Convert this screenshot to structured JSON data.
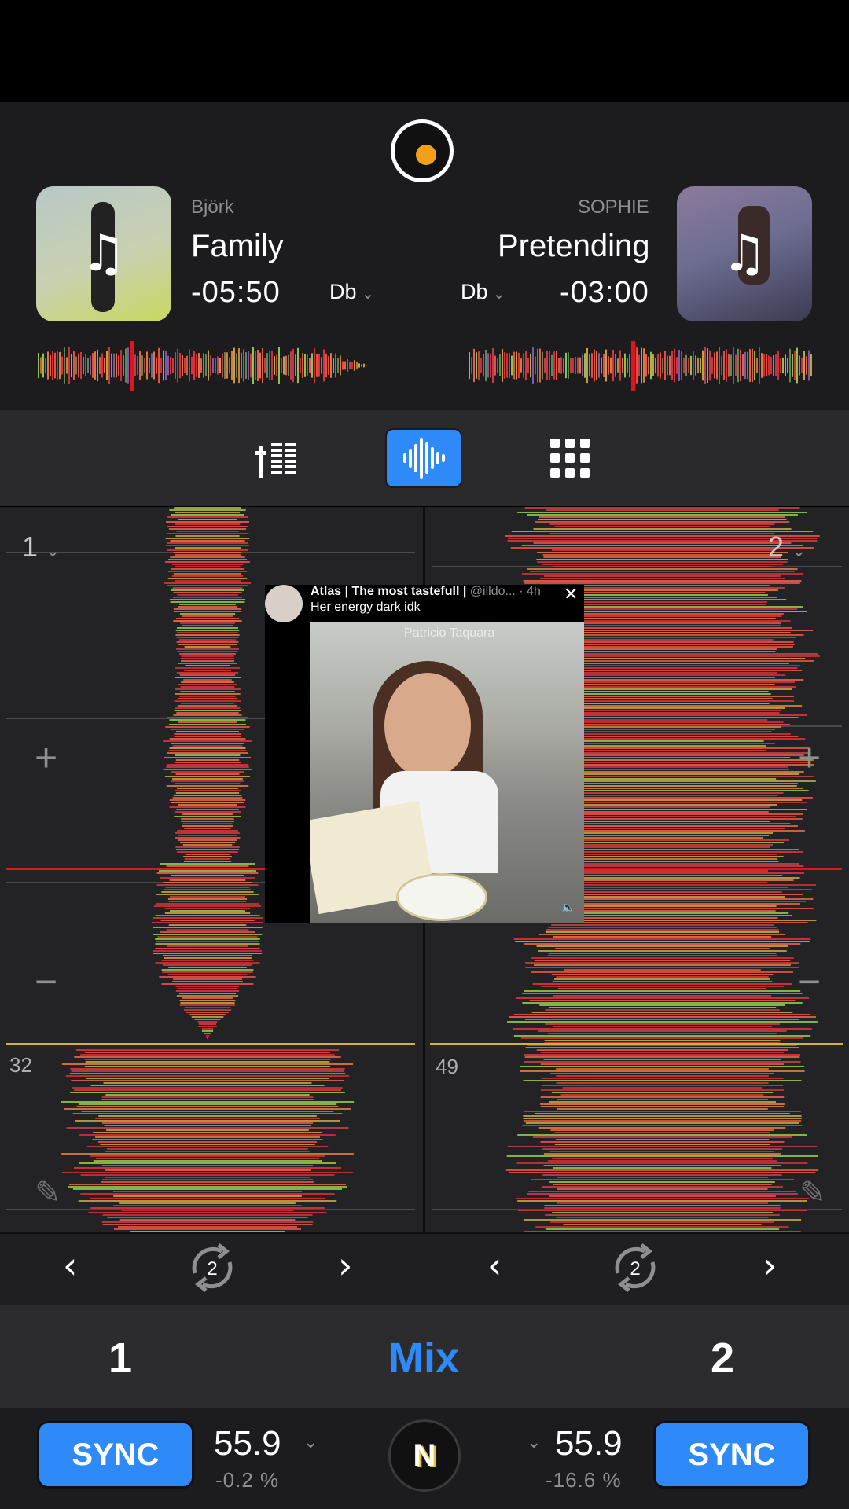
{
  "deck_a": {
    "artist": "Björk",
    "title": "Family",
    "time": "-05:50",
    "key": "Db",
    "deck_number": "1",
    "beat_marker": "32",
    "bpm": "55.9",
    "pitch": "-0.2 %",
    "sync_label": "SYNC",
    "loop_count": "2"
  },
  "deck_b": {
    "artist": "SOPHIE",
    "title": "Pretending",
    "time": "-03:00",
    "key": "Db",
    "deck_number": "2",
    "beat_marker": "49",
    "bpm": "55.9",
    "pitch": "-16.6 %",
    "sync_label": "SYNC",
    "loop_count": "2"
  },
  "mix_bar": {
    "left_label": "1",
    "center_label": "Mix",
    "right_label": "2"
  },
  "zoom_controls": {
    "plus": "+",
    "minus": "−"
  },
  "center_button_label": "N",
  "overlay_post": {
    "user": "Atlas | The most tastefull |",
    "handle": "@illdo... · 4h",
    "text": "Her energy dark idk",
    "location": "Patricio Taquara"
  },
  "colors": {
    "accent": "#2e8af8",
    "record_dot": "#f2a017",
    "playhead": "#e0141e",
    "cue_line": "#d4b23a"
  },
  "icons": {
    "record": "record-icon",
    "mixer": "mixer-icon",
    "waveform": "waveform-icon",
    "pads": "pads-grid-icon",
    "prev": "chevron-left-icon",
    "next": "chevron-right-icon",
    "loop": "loop-icon",
    "edit": "pencil-icon"
  }
}
